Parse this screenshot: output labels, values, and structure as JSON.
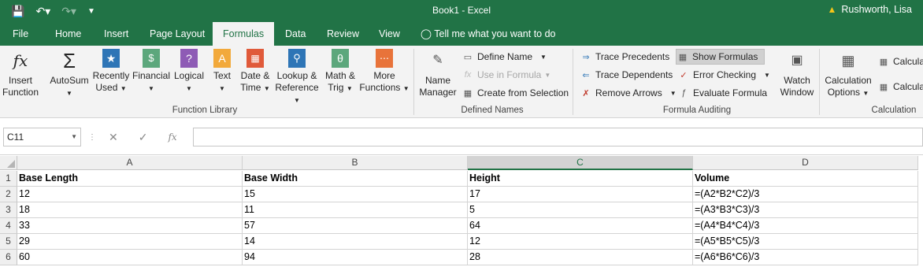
{
  "window": {
    "title": "Book1  -  Excel",
    "user": "Rushworth, Lisa"
  },
  "qat": {
    "save_icon": "save-icon",
    "undo_icon": "undo-icon",
    "redo_icon": "redo-icon",
    "customize_icon": "customize-icon"
  },
  "menu": {
    "tabs": [
      {
        "label": "File"
      },
      {
        "label": "Home"
      },
      {
        "label": "Insert"
      },
      {
        "label": "Page Layout"
      },
      {
        "label": "Formulas",
        "active": true
      },
      {
        "label": "Data"
      },
      {
        "label": "Review"
      },
      {
        "label": "View"
      }
    ],
    "tell_me": "Tell me what you want to do"
  },
  "ribbon": {
    "function_library": {
      "group_label": "Function Library",
      "insert_function": {
        "line1": "Insert",
        "line2": "Function"
      },
      "autosum": {
        "line1": "AutoSum"
      },
      "recently_used": {
        "line1": "Recently",
        "line2": "Used"
      },
      "financial": {
        "line1": "Financial"
      },
      "logical": {
        "line1": "Logical"
      },
      "text": {
        "line1": "Text"
      },
      "date_time": {
        "line1": "Date &",
        "line2": "Time"
      },
      "lookup_reference": {
        "line1": "Lookup &",
        "line2": "Reference"
      },
      "math_trig": {
        "line1": "Math &",
        "line2": "Trig"
      },
      "more_functions": {
        "line1": "More",
        "line2": "Functions"
      }
    },
    "defined_names": {
      "group_label": "Defined Names",
      "name_manager": {
        "line1": "Name",
        "line2": "Manager"
      },
      "define_name": "Define Name",
      "use_in_formula": "Use in Formula",
      "create_from_selection": "Create from Selection"
    },
    "formula_auditing": {
      "group_label": "Formula Auditing",
      "trace_precedents": "Trace Precedents",
      "trace_dependents": "Trace Dependents",
      "remove_arrows": "Remove Arrows",
      "show_formulas": "Show Formulas",
      "error_checking": "Error Checking",
      "evaluate_formula": "Evaluate Formula",
      "watch_window": {
        "line1": "Watch",
        "line2": "Window"
      }
    },
    "calculation": {
      "group_label": "Calculation",
      "options": {
        "line1": "Calculation",
        "line2": "Options"
      },
      "calc_now": "Calcula",
      "calc_sheet": "Calcula"
    }
  },
  "formula_bar": {
    "name_box": "C11",
    "content": ""
  },
  "sheet": {
    "columns": [
      "A",
      "B",
      "C",
      "D"
    ],
    "selected_column": "C",
    "rows": [
      {
        "num": "1",
        "cells": [
          "Base Length",
          "Base Width",
          "Height",
          "Volume"
        ],
        "bold": true
      },
      {
        "num": "2",
        "cells": [
          "12",
          "15",
          "17",
          "=(A2*B2*C2)/3"
        ]
      },
      {
        "num": "3",
        "cells": [
          "18",
          "11",
          "5",
          "=(A3*B3*C3)/3"
        ]
      },
      {
        "num": "4",
        "cells": [
          "33",
          "57",
          "64",
          "=(A4*B4*C4)/3"
        ]
      },
      {
        "num": "5",
        "cells": [
          "29",
          "14",
          "12",
          "=(A5*B5*C5)/3"
        ]
      },
      {
        "num": "6",
        "cells": [
          "60",
          "94",
          "28",
          "=(A6*B6*C6)/3"
        ]
      }
    ]
  },
  "colors": {
    "accent": "#217346",
    "ribbon_bg": "#f3f3f3"
  }
}
